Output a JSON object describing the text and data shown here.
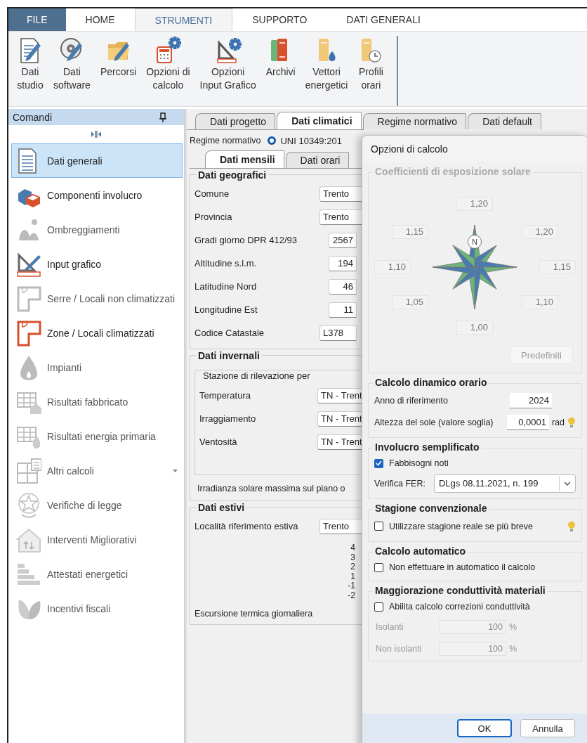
{
  "ribbon": {
    "tabs": [
      {
        "label": "FILE",
        "kind": "file",
        "selected": false
      },
      {
        "label": "HOME",
        "kind": "tab",
        "selected": false
      },
      {
        "label": "STRUMENTI",
        "kind": "tab",
        "selected": true
      },
      {
        "label": "SUPPORTO",
        "kind": "tab",
        "selected": false
      },
      {
        "label": "DATI GENERALI",
        "kind": "tab",
        "selected": false
      }
    ],
    "tools": [
      {
        "lines": [
          "Dati",
          "studio"
        ]
      },
      {
        "lines": [
          "Dati",
          "software"
        ]
      },
      {
        "lines": [
          "Percorsi"
        ]
      },
      {
        "lines": [
          "Opzioni di",
          "calcolo"
        ]
      },
      {
        "lines": [
          "Opzioni",
          "Input Grafico"
        ]
      },
      {
        "lines": [
          "Archivi"
        ]
      },
      {
        "lines": [
          "Vettori",
          "energetici"
        ]
      },
      {
        "lines": [
          "Profili",
          "orari"
        ]
      }
    ]
  },
  "sidebar": {
    "title": "Comandi",
    "items": [
      {
        "label": "Dati generali",
        "selected": true,
        "disabled": false,
        "has_menu": false
      },
      {
        "label": "Componenti involucro",
        "selected": false,
        "disabled": false,
        "has_menu": false
      },
      {
        "label": "Ombreggiamenti",
        "selected": false,
        "disabled": true,
        "has_menu": false
      },
      {
        "label": "Input grafico",
        "selected": false,
        "disabled": false,
        "has_menu": false
      },
      {
        "label": "Serre / Locali non climatizzati",
        "selected": false,
        "disabled": true,
        "has_menu": false
      },
      {
        "label": "Zone / Locali climatizzati",
        "selected": false,
        "disabled": false,
        "has_menu": false
      },
      {
        "label": "Impianti",
        "selected": false,
        "disabled": true,
        "has_menu": false
      },
      {
        "label": "Risultati fabbricato",
        "selected": false,
        "disabled": true,
        "has_menu": false
      },
      {
        "label": "Risultati energia primaria",
        "selected": false,
        "disabled": true,
        "has_menu": false
      },
      {
        "label": "Altri calcoli",
        "selected": false,
        "disabled": true,
        "has_menu": true
      },
      {
        "label": "Verifiche di legge",
        "selected": false,
        "disabled": true,
        "has_menu": false
      },
      {
        "label": "Interventi Migliorativi",
        "selected": false,
        "disabled": true,
        "has_menu": false
      },
      {
        "label": "Attestati energetici",
        "selected": false,
        "disabled": true,
        "has_menu": false
      },
      {
        "label": "Incentivi fiscali",
        "selected": false,
        "disabled": true,
        "has_menu": false
      }
    ]
  },
  "main": {
    "tabs": [
      {
        "label": "Dati progetto",
        "selected": false
      },
      {
        "label": "Dati climatici",
        "selected": true
      },
      {
        "label": "Regime normativo",
        "selected": false
      },
      {
        "label": "Dati default",
        "selected": false
      }
    ],
    "regime": {
      "label": "Regime normativo",
      "option": "UNI 10349:201",
      "selected": true
    },
    "subtabs": [
      {
        "label": "Dati mensili",
        "selected": true
      },
      {
        "label": "Dati orari",
        "selected": false
      }
    ],
    "geo": {
      "title": "Dati geografici",
      "rows": [
        {
          "label": "Comune",
          "value": "Trento",
          "kind": "combo"
        },
        {
          "label": "Provincia",
          "value": "Trento",
          "kind": "combo"
        },
        {
          "label": "Gradi giorno DPR 412/93",
          "value": "2567",
          "kind": "number"
        },
        {
          "label": "Altitudine s.l.m.",
          "value": "194",
          "kind": "number"
        },
        {
          "label": "Latitudine Nord",
          "value": "46",
          "kind": "number"
        },
        {
          "label": "Longitudine Est",
          "value": "11",
          "kind": "number"
        },
        {
          "label": "Codice Catastale",
          "value": "L378",
          "kind": "code"
        }
      ]
    },
    "winter": {
      "title": "Dati invernali",
      "station": {
        "title": "Stazione di rilevazione per",
        "rows": [
          {
            "label": "Temperatura",
            "value": "TN - Trent"
          },
          {
            "label": "Irraggiamento",
            "value": "TN - Trent"
          },
          {
            "label": "Ventosità",
            "value": "TN - Trent"
          }
        ]
      },
      "irradiance": "Irradianza solare massima sul piano o"
    },
    "summer": {
      "title": "Dati estivi",
      "location": {
        "label": "Località riferimento estiva",
        "value": "Trento"
      },
      "axis_labels": [
        "4",
        "3",
        "2",
        "1",
        "-1",
        "-2"
      ],
      "excursion": "Escursione termica giornaliera"
    }
  },
  "dialog": {
    "title": "Opzioni di calcolo",
    "exposure": {
      "title": "Coefficienti di esposizione solare",
      "disabled": true,
      "north": "N",
      "values": [
        {
          "kind": "n",
          "value": "1,20"
        },
        {
          "kind": "nw",
          "value": "1,15"
        },
        {
          "kind": "ne",
          "value": "1,20"
        },
        {
          "kind": "w",
          "value": "1,10"
        },
        {
          "kind": "e",
          "value": "1,15"
        },
        {
          "kind": "sw",
          "value": "1,05"
        },
        {
          "kind": "se",
          "value": "1,10"
        },
        {
          "kind": "s",
          "value": "1,00"
        }
      ],
      "button": "Predefiniti"
    },
    "dynamic": {
      "title": "Calcolo dinamico orario",
      "year_label": "Anno di riferimento",
      "year": "2024",
      "sun_label": "Altezza del sole (valore soglia)",
      "sun": "0,0001",
      "unit": "rad"
    },
    "envelope": {
      "title": "Involucro semplificato",
      "checkbox": {
        "label": "Fabbisogni noti",
        "checked": true
      },
      "fer_label": "Verifica FER:",
      "fer": "DLgs 08.11.2021, n. 199"
    },
    "season": {
      "title": "Stagione convenzionale",
      "checkbox": {
        "label": "Utilizzare stagione reale se più breve",
        "checked": false
      }
    },
    "auto": {
      "title": "Calcolo automatico",
      "checkbox": {
        "label": "Non effettuare in automatico il calcolo",
        "checked": false
      }
    },
    "conductivity": {
      "title": "Maggiorazione conduttività materiali",
      "checkbox": {
        "label": "Abilita calcolo correzioni conduttività",
        "checked": false
      },
      "rows": [
        {
          "label": "Isolanti",
          "value": "100",
          "unit": "%"
        },
        {
          "label": "Non isolanti",
          "value": "100",
          "unit": "%"
        }
      ]
    },
    "buttons": [
      {
        "label": "OK",
        "default": true
      },
      {
        "label": "Annulla",
        "default": false
      }
    ]
  }
}
